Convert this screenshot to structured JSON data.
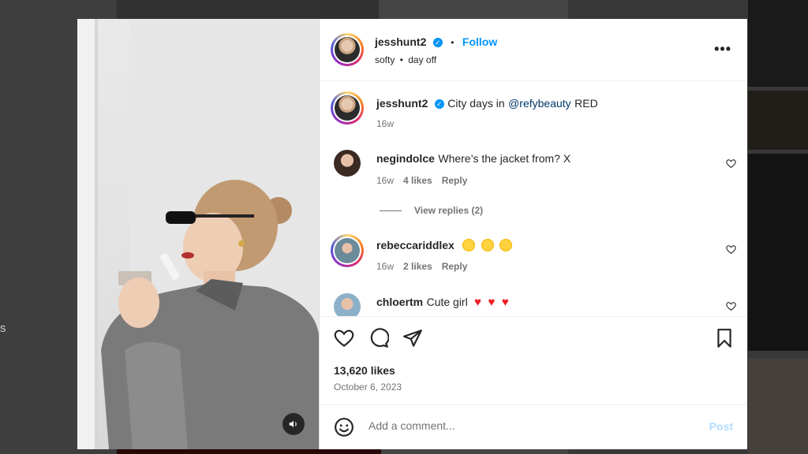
{
  "post": {
    "author": "jesshunt2",
    "follow_label": "Follow",
    "audio": "softy",
    "separator": "•",
    "location": "day off",
    "more_icon": "more-options-icon",
    "more_label": "•••"
  },
  "caption": {
    "author": "jesshunt2",
    "text_before": "City days in",
    "mention": "@refybeauty",
    "text_after": "RED",
    "time": "16w"
  },
  "comments": [
    {
      "author": "negindolce",
      "text": "Where’s the jacket from? X",
      "time": "16w",
      "likes": "4 likes",
      "reply_label": "Reply",
      "view_replies": "View replies (2)"
    },
    {
      "author": "rebeccariddlex",
      "text": "",
      "emojis": [
        "heart-eyes",
        "heart-eyes",
        "heart-eyes"
      ],
      "time": "16w",
      "likes": "2 likes",
      "reply_label": "Reply"
    },
    {
      "author": "chloertm",
      "text": "Cute girl",
      "emojis": [
        "red-heart",
        "red-heart",
        "red-heart"
      ]
    }
  ],
  "stats": {
    "likes": "13,620 likes",
    "date": "October 6, 2023"
  },
  "comment_box": {
    "placeholder": "Add a comment...",
    "post_label": "Post"
  },
  "colors": {
    "accent": "#0095f6",
    "post_disabled": "#b3dbff",
    "heart_red": "#ed1c24"
  }
}
